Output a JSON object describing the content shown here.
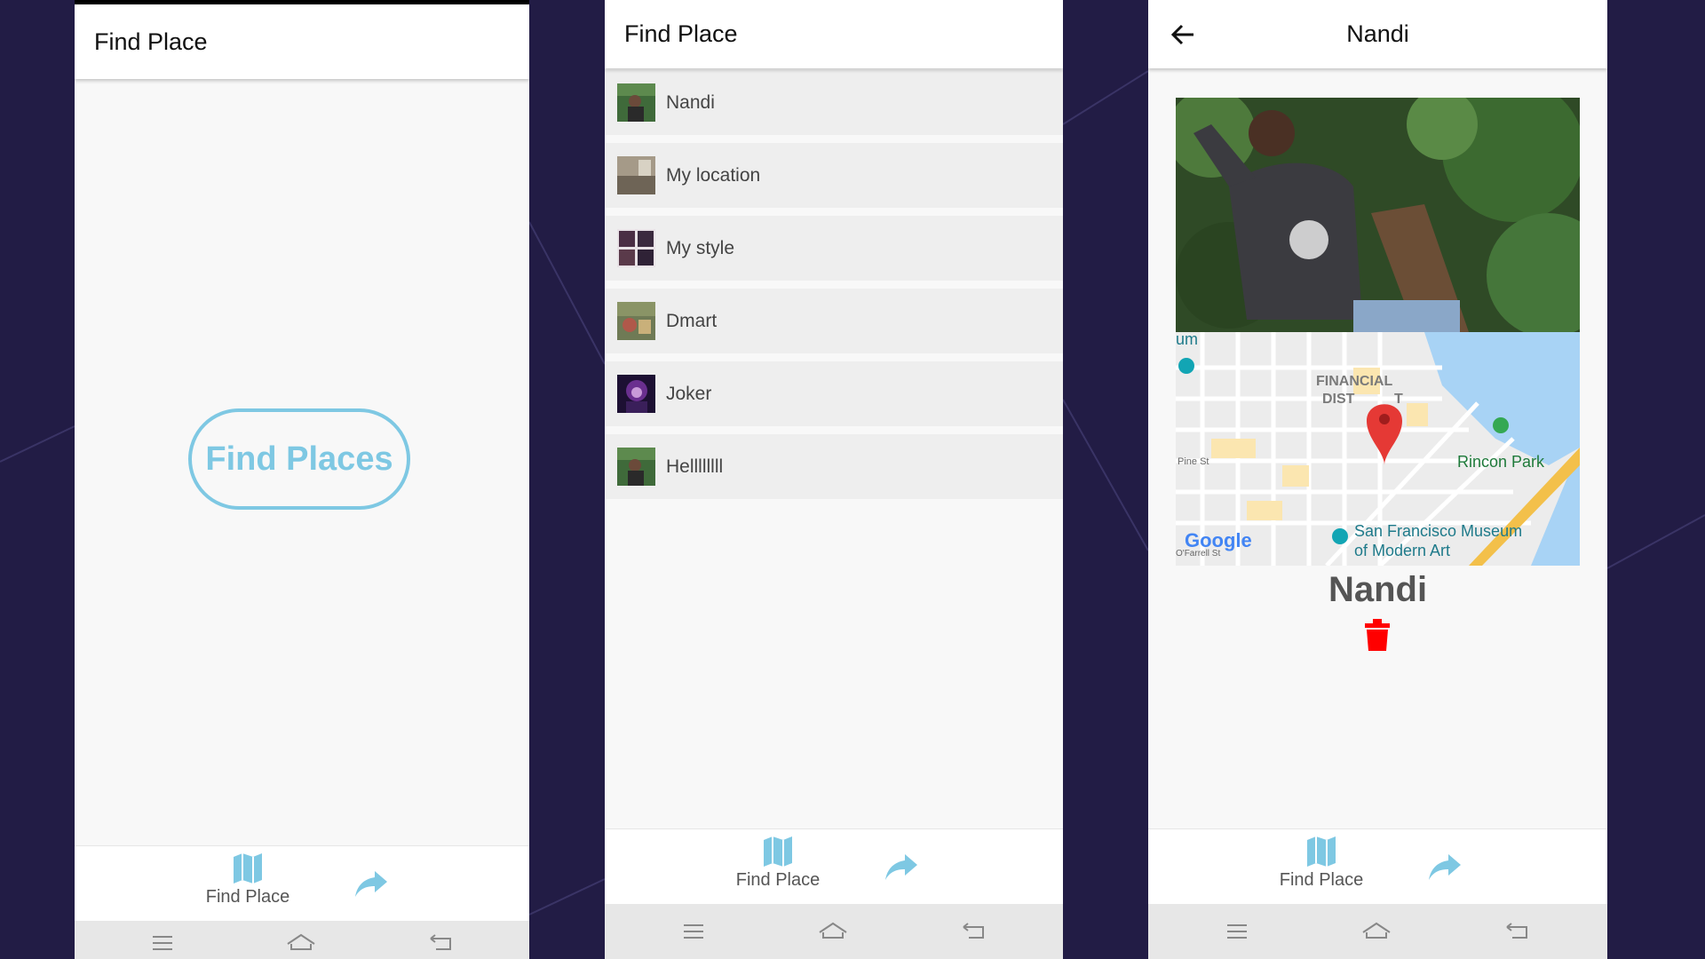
{
  "screens": [
    {
      "header": {
        "title": "Find Place"
      },
      "find_button_label": "Find Places",
      "tabs": {
        "main_label": "Find Place",
        "main_icon": "map-icon",
        "second_icon": "share-icon"
      }
    },
    {
      "header": {
        "title": "Find Place"
      },
      "places": [
        {
          "name": "Nandi",
          "thumb_color": "#3f6a3a"
        },
        {
          "name": "My location",
          "thumb_color": "#7d7466"
        },
        {
          "name": "My style",
          "thumb_color": "#5a3a4a"
        },
        {
          "name": "Dmart",
          "thumb_color": "#6f7a55"
        },
        {
          "name": "Joker",
          "thumb_color": "#3a1f5a"
        },
        {
          "name": "Hellllllll",
          "thumb_color": "#3f6a3a"
        }
      ],
      "tabs": {
        "main_label": "Find Place"
      }
    },
    {
      "header": {
        "title": "Nandi",
        "back_icon": "arrow-left-icon"
      },
      "place_name": "Nandi",
      "map": {
        "district_line1": "FINANCIAL",
        "district_line2": "DIST",
        "district_line2_suffix": "T",
        "street": "Pine St",
        "park": "Rincon Park",
        "museum_line1": "San Francisco Museum",
        "museum_line2": "of Modern Art",
        "corner_text": "um",
        "bottom_left_text": "O'Farrell St",
        "logo": "Google"
      },
      "tabs": {
        "main_label": "Find Place"
      }
    }
  ],
  "colors": {
    "accent": "#7ec8e3",
    "background": "#221c45",
    "delete": "#ff0000",
    "marker": "#e53935"
  }
}
